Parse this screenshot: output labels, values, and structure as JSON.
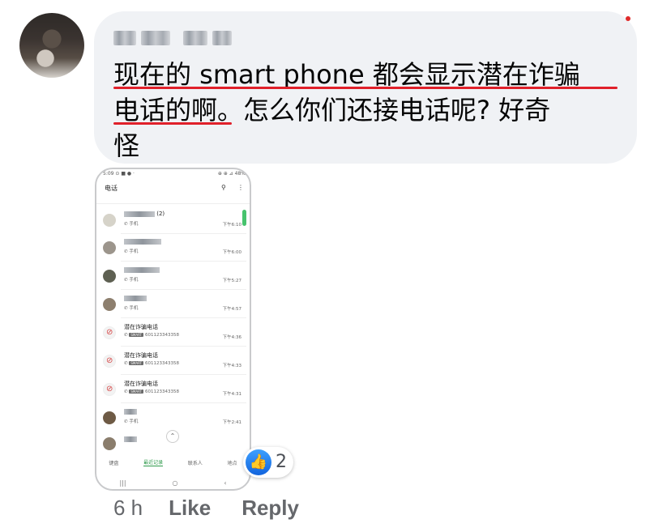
{
  "comment": {
    "author_label": "",
    "text_line1": "现在的 smart phone 都会显示潜在诈骗",
    "text_line2": "电话的啊。怎么你们还接电话呢? 好奇",
    "text_line3": "怪",
    "underline_color": "#e0202a",
    "bubble_color": "#f0f2f5"
  },
  "phone": {
    "status_left": "5:09 ⊙ ■ ● ·",
    "status_right": "⊕ ⊕ ⊿ 48%",
    "app_title": "电话",
    "search_icon": "search-icon",
    "more_icon": "more-vert-icon",
    "rows": [
      {
        "name_count": "(2)",
        "sub": "✆ 手机",
        "time": "下午6:10"
      },
      {
        "name_count": "",
        "sub": "✆ 手机",
        "time": "下午6:00"
      },
      {
        "name_count": "",
        "sub": "✆ 手机",
        "time": "下午5:27"
      },
      {
        "name_count": "",
        "sub": "✆ 手机",
        "time": "下午4:57"
      },
      {
        "name": "潜在诈骗电话",
        "badge": "SMART",
        "number": "601123343358",
        "time": "下午4:36"
      },
      {
        "name": "潜在诈骗电话",
        "badge": "SMART",
        "number": "601123343358",
        "time": "下午4:33"
      },
      {
        "name": "潜在诈骗电话",
        "badge": "SMART",
        "number": "601123343358",
        "time": "下午4:31"
      },
      {
        "name_count": "",
        "sub": "✆ 手机",
        "time": "下午2:41"
      }
    ],
    "tabs": [
      "键盘",
      "最近记录",
      "联系人",
      "地点"
    ],
    "nav": [
      "|||",
      "○",
      "‹"
    ]
  },
  "reaction": {
    "icon": "like-icon",
    "count": "2",
    "color": "#1877f2"
  },
  "actions": {
    "time": "6 h",
    "like": "Like",
    "reply": "Reply"
  }
}
